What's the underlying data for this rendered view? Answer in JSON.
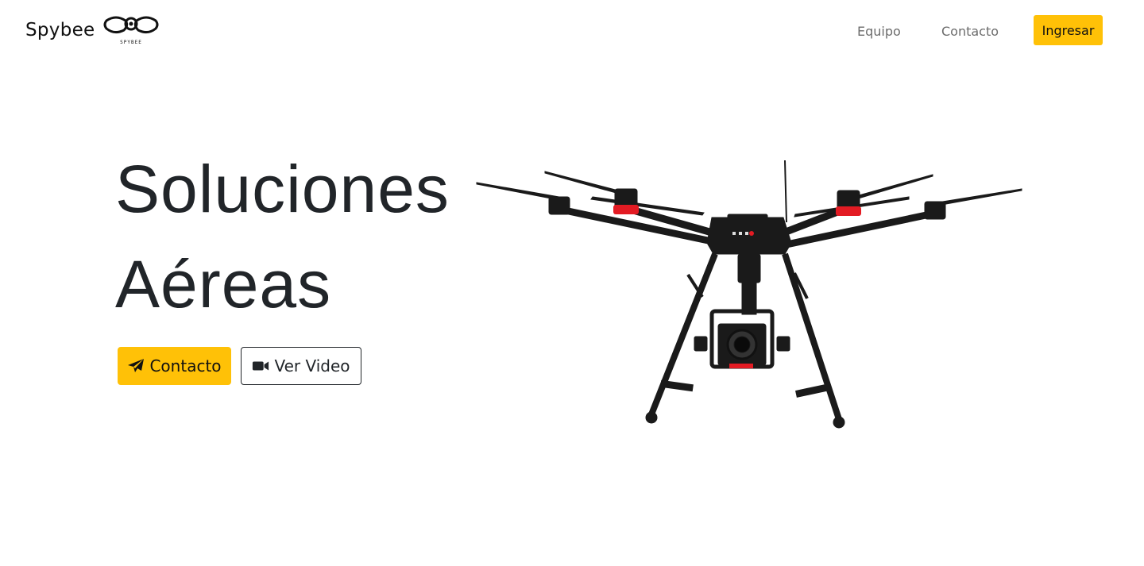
{
  "brand": {
    "name": "Spybee",
    "logo_text": "SPYBEE",
    "logo_icon": "bee-eyes-logo"
  },
  "nav": {
    "items": [
      {
        "label": "Equipo"
      },
      {
        "label": "Contacto"
      }
    ],
    "login_label": "Ingresar"
  },
  "hero": {
    "title_line1": "Soluciones",
    "title_line2": "Aéreas",
    "primary_button": {
      "label": "Contacto",
      "icon": "paper-plane-icon"
    },
    "secondary_button": {
      "label": "Ver Video",
      "icon": "video-camera-icon"
    },
    "image": "drone-image"
  },
  "colors": {
    "accent": "#ffc107",
    "text": "#212529",
    "nav_text": "#6c6c6c",
    "drone_red": "#e31b23"
  }
}
